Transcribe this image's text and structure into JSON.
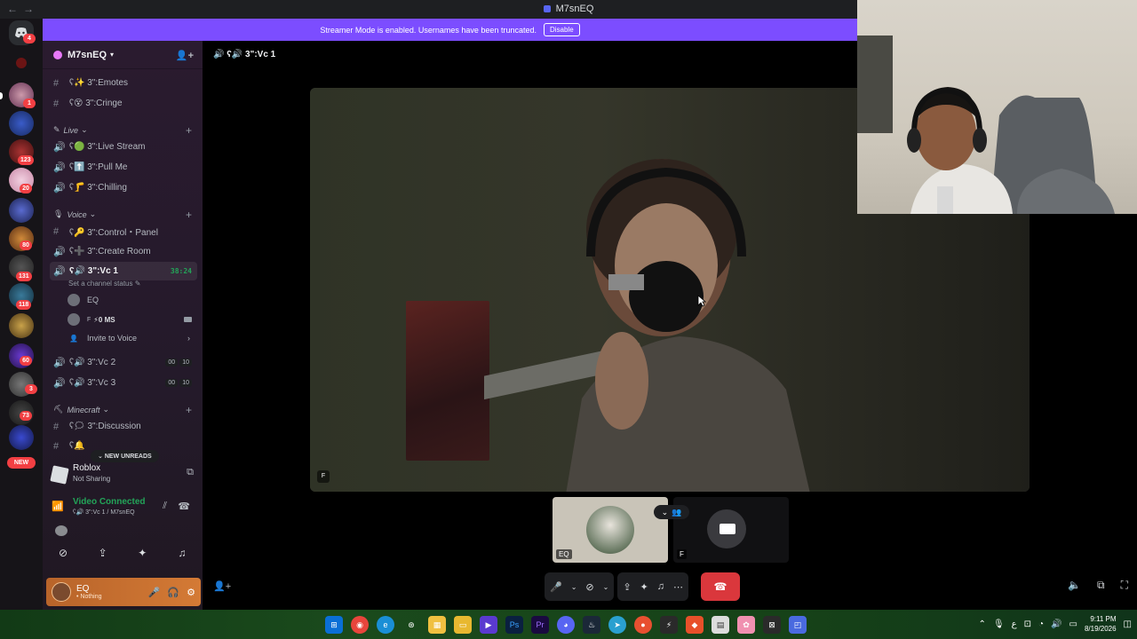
{
  "window": {
    "title": "M7snEQ",
    "nav_back": "←",
    "nav_fwd": "→"
  },
  "banner": {
    "text": "Streamer Mode is enabled. Usernames have been truncated.",
    "button": "Disable"
  },
  "rail": {
    "badges": [
      "4",
      "1",
      "123",
      "20",
      "80",
      "131",
      "118",
      "60",
      "3",
      "73"
    ],
    "new_label": "NEW"
  },
  "sidebar": {
    "server_name": "M7snEQ",
    "channels": {
      "emotes": "ʕ✨ 3\":Emotes",
      "cringe": "ʕ😵 3\":Cringe",
      "live_stream": "ʕ🟢 3\":Live Stream",
      "pull_me": "ʕ⬆️ 3\":Pull Me",
      "chilling": "ʕ🦵 3\":Chilling",
      "control_panel": "ʕ🔑 3\":Control・Panel",
      "create_room": "ʕ➕ 3\":Create Room",
      "vc1": "ʕ🔊 3\":Vc 1",
      "vc2": "ʕ🔊 3\":Vc 2",
      "vc3": "ʕ🔊 3\":Vc 3",
      "discussion": "ʕ🗯 3\":Discussion",
      "hidden": "ʕ🔔"
    },
    "categories": {
      "live": "Live",
      "voice": "Voice",
      "minecraft": "Minecraft"
    },
    "vc1_timer": "38:24",
    "vc1_status": "Set a channel status",
    "vc_users": {
      "u1": "EQ",
      "u2_prefix": "F",
      "u2_ping": "⚡0 MS"
    },
    "invite": "Invite to Voice",
    "vc2_counts": [
      "00",
      "10"
    ],
    "vc3_counts": [
      "00",
      "10"
    ],
    "new_unreads": "NEW UNREADS"
  },
  "activity": {
    "title": "Roblox",
    "subtitle": "Not Sharing"
  },
  "voice": {
    "title": "Video Connected",
    "subtitle": "ʕ🔊 3\":Vc 1 / M7snEQ"
  },
  "userbar": {
    "name": "EQ",
    "status": "• Nothing"
  },
  "main": {
    "header": "ʕ🔊 3\":Vc 1",
    "video_tag": "F",
    "thumb1_label": "EQ",
    "thumb2_label": "F"
  },
  "taskbar": {
    "time": "9:11 PM",
    "date": "8/19/2026"
  },
  "colors": {
    "accent": "#7c4dff",
    "danger": "#da373c",
    "online": "#23a559",
    "brand": "#5865f2"
  }
}
